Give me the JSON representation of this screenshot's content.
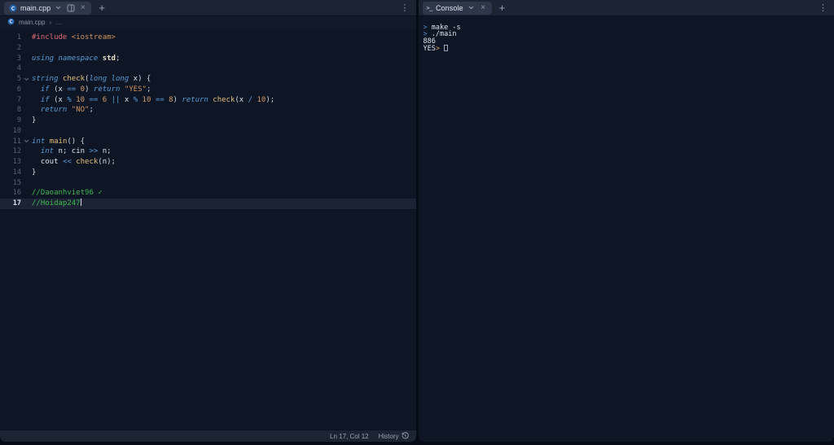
{
  "theme": {
    "background": "#0e1525",
    "surface": "#1c2333",
    "active_tab": "#2e374a",
    "comment_green": "#3fb950",
    "keyword_blue": "#569cd6",
    "preprocessor_red": "#e06c75",
    "string_orange": "#cf9360",
    "number_orange": "#d19a66",
    "function_yellow": "#e5c07b",
    "prompt_blue": "#4e8cc9",
    "prompt_orange": "#dba35c"
  },
  "icons": {
    "plus": "+",
    "close": "×",
    "kebab": "⋮",
    "terminal": ">_"
  },
  "editor": {
    "tab": {
      "label": "main.cpp"
    },
    "breadcrumb": {
      "file": "main.cpp",
      "separator": "›",
      "more": "…"
    },
    "status": {
      "position": "Ln 17, Col 12",
      "history": "History"
    },
    "lines": [
      {
        "n": 1,
        "tokens": [
          [
            "pre",
            "#include "
          ],
          [
            "str",
            "<iostream>"
          ]
        ]
      },
      {
        "n": 2,
        "tokens": []
      },
      {
        "n": 3,
        "tokens": [
          [
            "kw",
            "using "
          ],
          [
            "kw",
            "namespace "
          ],
          [
            "ns",
            "std"
          ],
          [
            "pn",
            ";"
          ]
        ]
      },
      {
        "n": 4,
        "tokens": []
      },
      {
        "n": 5,
        "fold": true,
        "tokens": [
          [
            "kw",
            "string "
          ],
          [
            "fn",
            "check"
          ],
          [
            "pn",
            "("
          ],
          [
            "kw",
            "long long "
          ],
          [
            "id",
            "x"
          ],
          [
            "pn",
            ") {"
          ]
        ]
      },
      {
        "n": 6,
        "tokens": [
          [
            "pl",
            "  "
          ],
          [
            "kw",
            "if "
          ],
          [
            "pn",
            "("
          ],
          [
            "id",
            "x "
          ],
          [
            "op",
            "== "
          ],
          [
            "num",
            "0"
          ],
          [
            "pn",
            ") "
          ],
          [
            "kw",
            "return "
          ],
          [
            "str",
            "\"YES\""
          ],
          [
            "pn",
            ";"
          ]
        ]
      },
      {
        "n": 7,
        "tokens": [
          [
            "pl",
            "  "
          ],
          [
            "kw",
            "if "
          ],
          [
            "pn",
            "("
          ],
          [
            "id",
            "x "
          ],
          [
            "op",
            "% "
          ],
          [
            "num",
            "10 "
          ],
          [
            "op",
            "== "
          ],
          [
            "num",
            "6 "
          ],
          [
            "op",
            "|| "
          ],
          [
            "id",
            "x "
          ],
          [
            "op",
            "% "
          ],
          [
            "num",
            "10 "
          ],
          [
            "op",
            "== "
          ],
          [
            "num",
            "8"
          ],
          [
            "pn",
            ") "
          ],
          [
            "kw",
            "return "
          ],
          [
            "fn",
            "check"
          ],
          [
            "pn",
            "("
          ],
          [
            "id",
            "x "
          ],
          [
            "op",
            "/ "
          ],
          [
            "num",
            "10"
          ],
          [
            "pn",
            ");"
          ]
        ]
      },
      {
        "n": 8,
        "tokens": [
          [
            "pl",
            "  "
          ],
          [
            "kw",
            "return "
          ],
          [
            "str",
            "\"NO\""
          ],
          [
            "pn",
            ";"
          ]
        ]
      },
      {
        "n": 9,
        "tokens": [
          [
            "pn",
            "}"
          ]
        ]
      },
      {
        "n": 10,
        "tokens": []
      },
      {
        "n": 11,
        "fold": true,
        "tokens": [
          [
            "kw",
            "int "
          ],
          [
            "fn",
            "main"
          ],
          [
            "pn",
            "() {"
          ]
        ]
      },
      {
        "n": 12,
        "tokens": [
          [
            "pl",
            "  "
          ],
          [
            "kw",
            "int "
          ],
          [
            "id",
            "n"
          ],
          [
            "pn",
            "; "
          ],
          [
            "id",
            "cin "
          ],
          [
            "op",
            ">> "
          ],
          [
            "id",
            "n"
          ],
          [
            "pn",
            ";"
          ]
        ]
      },
      {
        "n": 13,
        "tokens": [
          [
            "pl",
            "  "
          ],
          [
            "id",
            "cout "
          ],
          [
            "op",
            "<< "
          ],
          [
            "fn",
            "check"
          ],
          [
            "pn",
            "("
          ],
          [
            "id",
            "n"
          ],
          [
            "pn",
            ");"
          ]
        ]
      },
      {
        "n": 14,
        "tokens": [
          [
            "pn",
            "}"
          ]
        ]
      },
      {
        "n": 15,
        "tokens": []
      },
      {
        "n": 16,
        "tokens": [
          [
            "cmt",
            "//Daoanhviet96 ✓"
          ]
        ]
      },
      {
        "n": 17,
        "active": true,
        "cursor": true,
        "tokens": [
          [
            "cmt",
            "//Hoidap247"
          ]
        ]
      }
    ]
  },
  "console": {
    "tab": {
      "label": "Console"
    },
    "lines": [
      {
        "tokens": [
          [
            "pb",
            "> "
          ],
          [
            "t",
            "make -s"
          ]
        ]
      },
      {
        "tokens": [
          [
            "pb",
            "> "
          ],
          [
            "t",
            "./main"
          ]
        ]
      },
      {
        "tokens": [
          [
            "t",
            "886"
          ]
        ]
      },
      {
        "tokens": [
          [
            "t",
            "YES"
          ],
          [
            "po",
            "> "
          ],
          [
            "cur",
            ""
          ]
        ]
      }
    ]
  }
}
